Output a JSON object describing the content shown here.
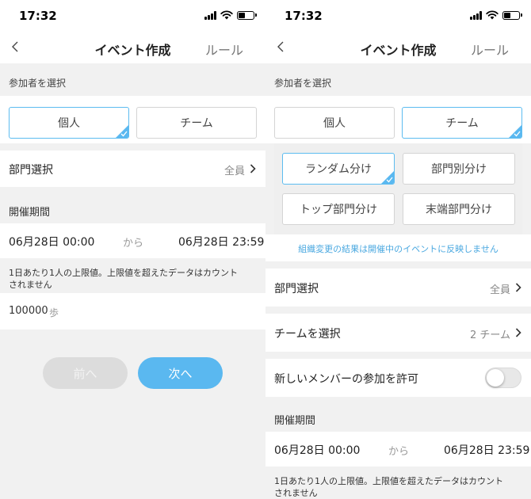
{
  "left": {
    "status": {
      "time": "17:32"
    },
    "nav": {
      "title": "イベント作成",
      "rule": "ルール"
    },
    "participants": {
      "label": "参加者を選択",
      "individual": "個人",
      "team": "チーム",
      "selected": "個人"
    },
    "department": {
      "label": "部門選択",
      "value": "全員"
    },
    "period": {
      "label": "開催期間",
      "start": "06月28日 00:00",
      "separator": "から",
      "end": "06月28日 23:59"
    },
    "limit_note": "1日あたり1人の上限値。上限値を超えたデータはカウントされません",
    "steps": {
      "value": "100000",
      "unit": "歩"
    },
    "buttons": {
      "prev": "前へ",
      "next": "次へ"
    }
  },
  "right": {
    "status": {
      "time": "17:32"
    },
    "nav": {
      "title": "イベント作成",
      "rule": "ルール"
    },
    "participants": {
      "label": "参加者を選択",
      "individual": "個人",
      "team": "チーム",
      "selected": "チーム"
    },
    "team_modes": {
      "random": "ランダム分け",
      "by_department": "部門別分け",
      "top_department": "トップ部門分け",
      "leaf_department": "末端部門分け",
      "selected": "ランダム分け"
    },
    "org_change_notice": "組織変更の結果は開催中のイベントに反映しません",
    "department": {
      "label": "部門選択",
      "value": "全員"
    },
    "team_select": {
      "label": "チームを選択",
      "value": "2 チーム"
    },
    "allow_new_members": {
      "label": "新しいメンバーの参加を許可",
      "enabled": false
    },
    "period": {
      "label": "開催期間",
      "start": "06月28日 00:00",
      "separator": "から",
      "end": "06月28日 23:59"
    },
    "limit_note": "1日あたり1人の上限値。上限値を超えたデータはカウントされません"
  },
  "colors": {
    "accent": "#5ab8f0",
    "selected_border": "#5cbcf0",
    "notice_text": "#4aa8e0",
    "disabled_button": "#dcdcdc",
    "background": "#f1f1f1"
  },
  "icons": {
    "back": "chevron-left-icon",
    "row_arrow": "chevron-right-icon",
    "selected_mark": "check-corner-icon",
    "signal": "signal-icon",
    "wifi": "wifi-icon",
    "battery": "battery-icon"
  }
}
